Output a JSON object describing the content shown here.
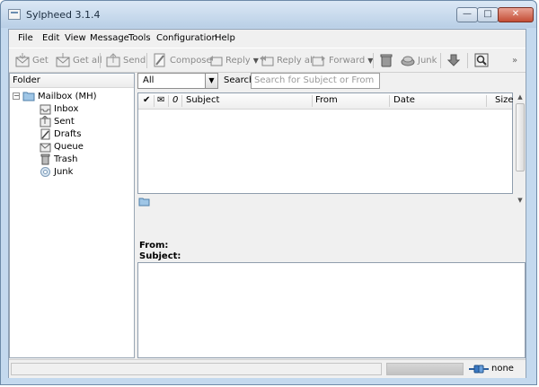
{
  "window": {
    "title": "Sylpheed 3.1.4"
  },
  "menubar": [
    {
      "label": "File"
    },
    {
      "label": "Edit"
    },
    {
      "label": "View"
    },
    {
      "label": "Message"
    },
    {
      "label": "Tools"
    },
    {
      "label": "Configuration"
    },
    {
      "label": "Help"
    }
  ],
  "toolbar": {
    "get": "Get",
    "get_all": "Get all",
    "send": "Send",
    "compose": "Compose",
    "reply": "Reply",
    "reply_all": "Reply all",
    "forward": "Forward",
    "junk": "Junk",
    "more": "»"
  },
  "folder_pane": {
    "header": "Folder",
    "mailbox": "Mailbox (MH)",
    "folders": [
      {
        "label": "Inbox",
        "icon": "inbox-icon"
      },
      {
        "label": "Sent",
        "icon": "sent-icon"
      },
      {
        "label": "Drafts",
        "icon": "drafts-icon"
      },
      {
        "label": "Queue",
        "icon": "queue-icon"
      },
      {
        "label": "Trash",
        "icon": "trash-icon"
      },
      {
        "label": "Junk",
        "icon": "junk-icon"
      }
    ]
  },
  "filter": {
    "selected": "All"
  },
  "search": {
    "label": "Search:",
    "placeholder": "Search for Subject or From"
  },
  "message_list": {
    "columns": [
      "✔",
      "✉",
      "0",
      "Subject",
      "From",
      "Date",
      "Size"
    ]
  },
  "message_view": {
    "from_label": "From:",
    "subject_label": "Subject:"
  },
  "statusbar": {
    "status": "none"
  },
  "colors": {
    "title_bar": "#c4d9ee",
    "window_border": "#6d8aa8",
    "disabled_text": "#8a8a8a"
  }
}
